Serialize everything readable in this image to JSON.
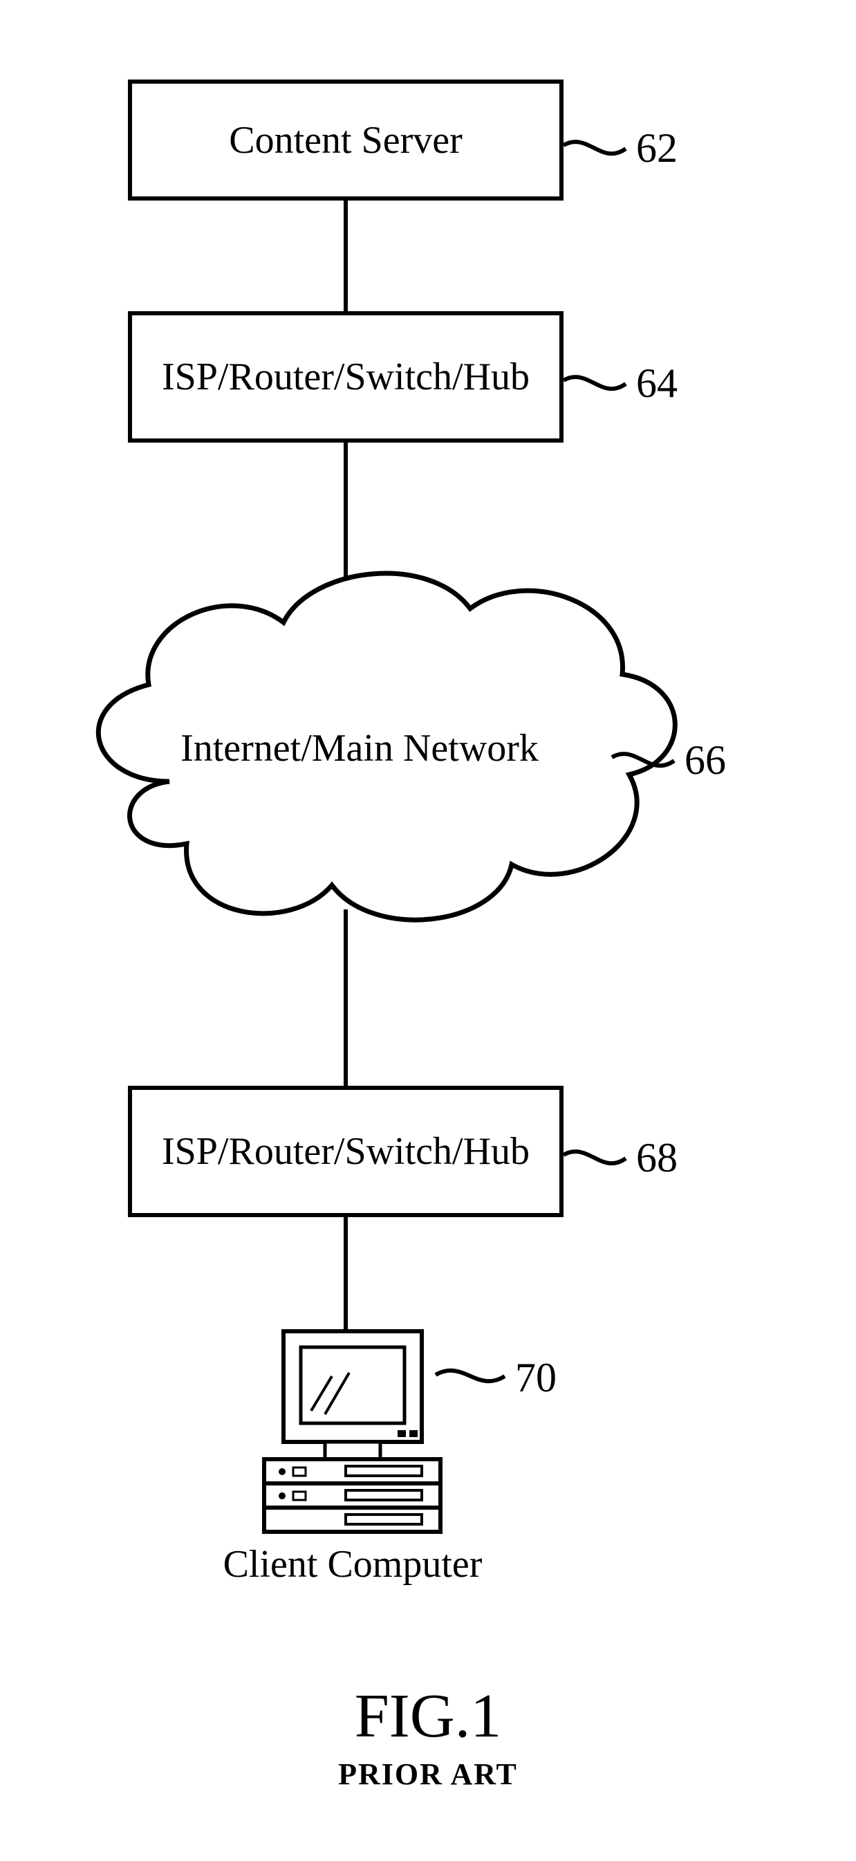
{
  "nodes": {
    "content_server": {
      "label": "Content Server",
      "ref": "62"
    },
    "isp_top": {
      "label": "ISP/Router/Switch/Hub",
      "ref": "64"
    },
    "internet": {
      "label": "Internet/Main Network",
      "ref": "66"
    },
    "isp_bottom": {
      "label": "ISP/Router/Switch/Hub",
      "ref": "68"
    },
    "client": {
      "label": "Client Computer",
      "ref": "70"
    }
  },
  "caption": {
    "fig": "FIG.1",
    "sub": "PRIOR ART"
  }
}
